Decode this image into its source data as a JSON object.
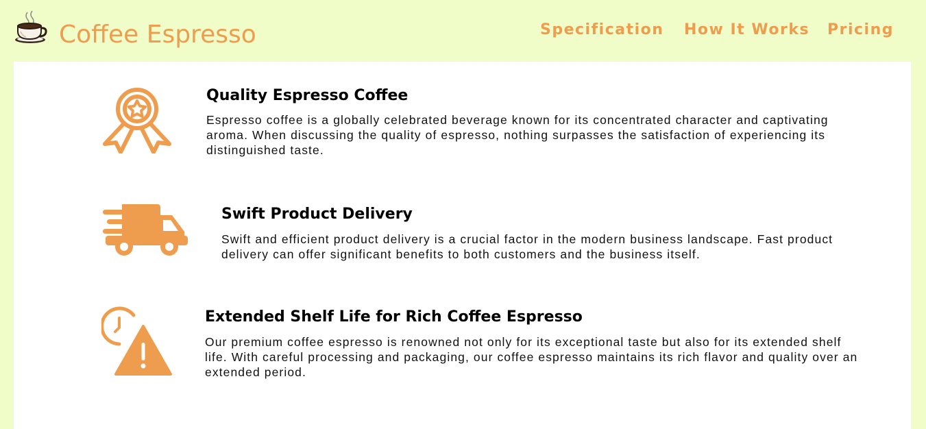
{
  "header": {
    "brand": "Coffee Espresso",
    "nav": {
      "specification": "Specification",
      "how_it_works": "How It Works",
      "pricing": "Pricing"
    }
  },
  "features": [
    {
      "icon": "award-ribbon-icon",
      "title": "Quality Espresso Coffee",
      "text": "Espresso coffee is a globally celebrated beverage known for its concentrated character and captivating aroma. When discussing the quality of espresso, nothing surpasses the satisfaction of experiencing its distinguished taste."
    },
    {
      "icon": "delivery-truck-icon",
      "title": "Swift Product Delivery",
      "text": "Swift and efficient product delivery is a crucial factor in the modern business landscape. Fast product delivery can offer significant benefits to both customers and the business itself."
    },
    {
      "icon": "clock-warning-icon",
      "title": "Extended Shelf Life for Rich Coffee Espresso",
      "text": "Our premium coffee espresso is renowned not only for its exceptional taste but also for its extended shelf life. With careful processing and packaging, our coffee espresso maintains its rich flavor and quality over an extended period."
    }
  ],
  "colors": {
    "page_background": "#f0fdc9",
    "accent": "#ee9d4e",
    "card_background": "#ffffff"
  }
}
